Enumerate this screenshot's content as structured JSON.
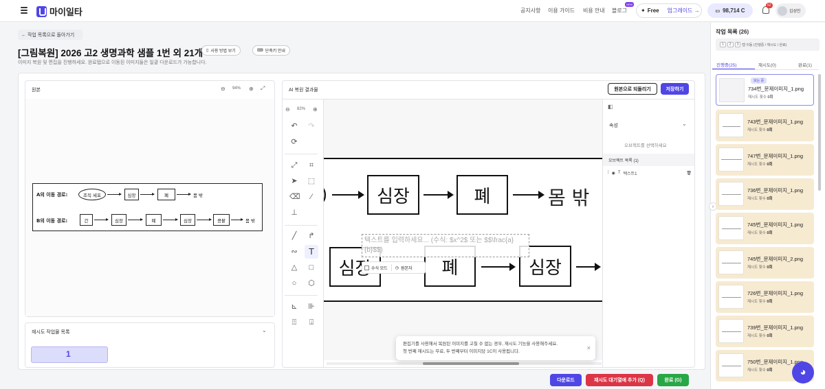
{
  "header": {
    "logo": "마이일타",
    "nav": [
      "공지사항",
      "이용 가이드",
      "비용 안내",
      "블로그"
    ],
    "new_badge": "NEW",
    "plan": "Free",
    "upgrade": "업그레이드 →",
    "credits": "98,714 C",
    "bell_count": "52",
    "user_name": "김성민"
  },
  "page": {
    "back_label": "← 작업 목록으로 돌아가기",
    "title": "[그림복원] 2026 고2 생명과학 샘플 1번 외 21개",
    "how_to": "사용 방법 보기",
    "shortcuts": "단축키 안내",
    "subtitle": "이미지 복원 및 편집을 진행하세요. 완료탭으로 이동된 이미지들은 일괄 다운로드가 가능합니다."
  },
  "original": {
    "label": "원본",
    "zoom": "94%",
    "row_a": {
      "label": "A의 이동 경로:",
      "start": "조직 세포",
      "items": [
        "심장",
        "폐",
        "몸 밖"
      ]
    },
    "row_b": {
      "label": "B의 이동 경로:",
      "items": [
        "간",
        "심장",
        "폐",
        "심장",
        "콩팥",
        "몸 밖"
      ]
    }
  },
  "retry": {
    "label": "재시도 작업물 목록",
    "thumb_badge": "1"
  },
  "editor": {
    "label": "AI 복원 결과물",
    "revert": "원본으로 되돌리기",
    "save": "저장하기",
    "zoom": "82%",
    "row1": [
      "심장",
      "폐",
      "몸 밖"
    ],
    "row2": [
      "심장",
      "폐",
      "심장"
    ],
    "text_placeholder": "텍스트를 입력하세요... (수식: $x^2$ 또는 $$\\frac{a}{b}$$)",
    "formula_mode": "수식 모드",
    "origin": "원본자"
  },
  "props": {
    "title": "속성",
    "empty": "오브젝트를 선택하세요",
    "objects_title": "오브젝트 목록 (1)",
    "object_item": "텍스트1"
  },
  "toast": {
    "line1": "편집기를 사용해서 복원된 이미지를 고칠 수 없는 경우, 재시도 기능을 사용해주세요.",
    "line2": "첫 번째 재시도는 무료, 두 번째부터 이미지당 1C이 사용됩니다."
  },
  "actions": {
    "download": "다운로드",
    "requeue": "재시도 대기열에 추가 (Q)",
    "done": "완료 (G)"
  },
  "tasks": {
    "title": "작업 목록 (26)",
    "nav_hint": "탭 이동 (진행중 / 재시도 / 완료)",
    "keys": [
      "1",
      "2",
      "3"
    ],
    "tabs": [
      "진행중(25)",
      "재시도(0)",
      "완료(1)"
    ],
    "status_badge": "보는 중",
    "retry_label": "재시도 횟수",
    "items": [
      {
        "name": "734번_문제이미지_1.png",
        "retries": "0회"
      },
      {
        "name": "743번_문제이미지_1.png",
        "retries": "0회"
      },
      {
        "name": "747번_문제이미지_1.png",
        "retries": "0회"
      },
      {
        "name": "736번_문제이미지_1.png",
        "retries": "0회"
      },
      {
        "name": "745번_문제이미지_1.png",
        "retries": "0회"
      },
      {
        "name": "745번_문제이미지_2.png",
        "retries": "0회"
      },
      {
        "name": "726번_문제이미지_1.png",
        "retries": "0회"
      },
      {
        "name": "739번_문제이미지_1.png",
        "retries": "0회"
      },
      {
        "name": "750번_문제이미지_1.png",
        "retries": "0회"
      }
    ]
  },
  "colors": {
    "accent": "#4f46e5",
    "danger": "#dc3545",
    "success": "#28a745",
    "card": "#f6ead1"
  }
}
